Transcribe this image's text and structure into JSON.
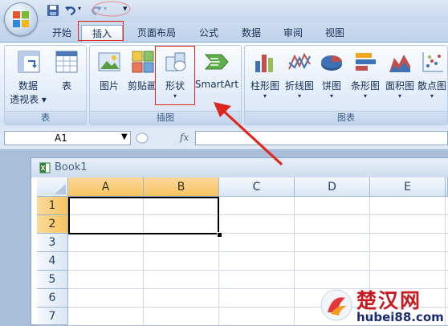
{
  "qat": {
    "save": "save-icon",
    "undo": "undo-icon",
    "redo": "redo-icon",
    "customize": "▾"
  },
  "tabs": [
    "开始",
    "插入",
    "页面布局",
    "公式",
    "数据",
    "审阅",
    "视图"
  ],
  "active_tab": "插入",
  "ribbon": {
    "groups": [
      {
        "label": "表",
        "buttons": [
          {
            "label": "数据",
            "label2": "透视表 ▾",
            "icon": "pivot-table-icon"
          },
          {
            "label": "表",
            "icon": "table-icon"
          }
        ]
      },
      {
        "label": "插图",
        "buttons": [
          {
            "label": "图片",
            "icon": "picture-icon"
          },
          {
            "label": "剪贴画",
            "icon": "clipart-icon"
          },
          {
            "label": "形状",
            "icon": "shapes-icon",
            "dropdown": "▾"
          },
          {
            "label": "SmartArt",
            "icon": "smartart-icon"
          }
        ]
      },
      {
        "label": "图表",
        "buttons": [
          {
            "label": "柱形图",
            "icon": "column-chart-icon",
            "dropdown": "▾"
          },
          {
            "label": "折线图",
            "icon": "line-chart-icon",
            "dropdown": "▾"
          },
          {
            "label": "饼图",
            "icon": "pie-chart-icon",
            "dropdown": "▾"
          },
          {
            "label": "条形图",
            "icon": "bar-chart-icon",
            "dropdown": "▾"
          },
          {
            "label": "面积图",
            "icon": "area-chart-icon",
            "dropdown": "▾"
          },
          {
            "label": "散点图",
            "icon": "scatter-chart-icon",
            "dropdown": "▾"
          }
        ]
      }
    ]
  },
  "formula_bar": {
    "name_box": "A1",
    "fx": "fx",
    "value": ""
  },
  "workbook": {
    "title": "Book1",
    "columns": [
      "A",
      "B",
      "C",
      "D",
      "E"
    ],
    "selected_columns": [
      "A",
      "B"
    ],
    "rows": [
      "1",
      "2",
      "3",
      "4",
      "5",
      "6",
      "7"
    ],
    "selected_rows": [
      "1",
      "2"
    ]
  },
  "watermark": {
    "text": "楚汉网",
    "url": "hubei88.com"
  },
  "colors": {
    "highlight": "#e0261c",
    "selected_header": "#f7c463",
    "ribbon": "#dfe9f5"
  }
}
